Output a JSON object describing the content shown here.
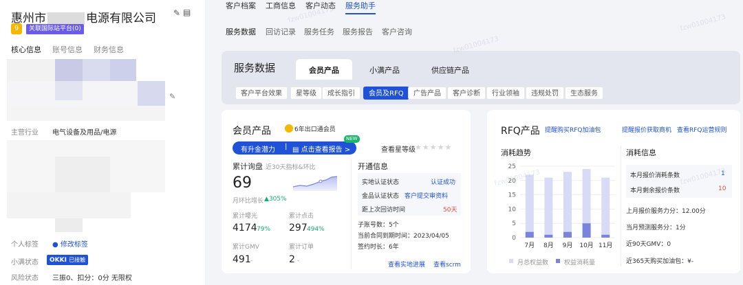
{
  "company": {
    "name_prefix": "惠州市",
    "name_suffix": "电源有限公司",
    "badge": "关联国际站平台(0)",
    "tabs": [
      "核心信息",
      "账号信息",
      "财务信息"
    ],
    "industry_label": "主营行业",
    "industry_value": "电气设备及用品/电源",
    "tag_label": "个人标签",
    "tag_action": "修改标签",
    "xiaoman_label": "小满状态",
    "okki_text": "OKKI",
    "okki_sub": "已接触",
    "risk_label": "风险状态",
    "risk_value": "三振0、扣分：0分 无限权"
  },
  "top_tabs": [
    "客户档案",
    "工商信息",
    "客户动态",
    "服务助手"
  ],
  "sub_tabs": [
    "服务数据",
    "回访记录",
    "服务任务",
    "服务报告",
    "客户咨询"
  ],
  "service_panel": {
    "title": "服务数据",
    "product_tabs": [
      "会员产品",
      "小满产品",
      "供应链产品"
    ],
    "chips": [
      "客户平台效果",
      "星等级",
      "成长指引",
      "会员及RFQ",
      "广告产品",
      "客户诊断",
      "行业领袖",
      "违规处罚",
      "生态服务"
    ]
  },
  "member": {
    "title": "会员产品",
    "badge": "6年出口通会员",
    "upgrade_text": "有升金潜力",
    "report_link": "点击查看报告 >",
    "new_badge": "NEW",
    "star_label": "查看星等级",
    "inquiry_label": "累计询盘",
    "inquiry_hint": "近30天指标&环比",
    "inquiry_value": "69",
    "mom_label": "月环比增长",
    "mom_value": "305%",
    "exposure_label": "累计曝光",
    "exposure_value": "4174",
    "exposure_pct": "79%",
    "click_label": "累计点击",
    "click_value": "297",
    "click_pct": "494%",
    "gmv_label": "累计GMV",
    "gmv_value": "491",
    "gmv_pct": "-",
    "order_label": "累计订单",
    "order_value": "2",
    "order_pct": "-",
    "open_title": "开通信息",
    "open_rows": [
      {
        "k": "实地认证状态",
        "v": "认证成功",
        "c": "blue"
      },
      {
        "k": "金品认证状态",
        "v": "客户提交审资料",
        "c": "blue"
      },
      {
        "k": "距上次回访时间",
        "v": "50天",
        "c": "red"
      }
    ],
    "sub_accounts": "子账号数：5个",
    "contract_expiry": "当前合同到期时间：2023/04/05",
    "signing_years": "签约时长：6年",
    "link_field": "查看实地进展",
    "link_scrm": "查看scrm"
  },
  "rfq": {
    "title": "RFQ产品",
    "links": [
      "提醒购买RFQ加油包",
      "提醒报价获取商机",
      "查看RFQ运营规则"
    ],
    "trend_title": "消耗趋势",
    "info_title": "消耗信息",
    "month_left_label": "本月报价消耗条数",
    "month_left_value": "1",
    "month_remaining_label": "本月剩余报价条数",
    "month_remaining_value": "10",
    "last_month_score": "上月报价服务力分：12.00分",
    "month_forecast": "当月预测服务分：1分",
    "gmv_90": "近90天GMV：0",
    "boost_365": "近365天购买加油包：¥-",
    "legend": [
      "月总权益数",
      "权益消耗量"
    ],
    "watermark": "fzw01004173"
  },
  "chart_data": {
    "type": "bar",
    "categories": [
      "7月",
      "8月",
      "9月",
      "10月",
      "11月"
    ],
    "series": [
      {
        "name": "月总权益数",
        "values": [
          22,
          21,
          23,
          24,
          21
        ]
      },
      {
        "name": "权益消耗量",
        "values": [
          2,
          1,
          2,
          5,
          1
        ]
      }
    ],
    "ylim": [
      0,
      25
    ],
    "yticks": [
      0,
      5,
      10,
      15,
      20,
      25
    ],
    "colors": {
      "total": "#d8dbf5",
      "used": "#7b84dc"
    }
  }
}
